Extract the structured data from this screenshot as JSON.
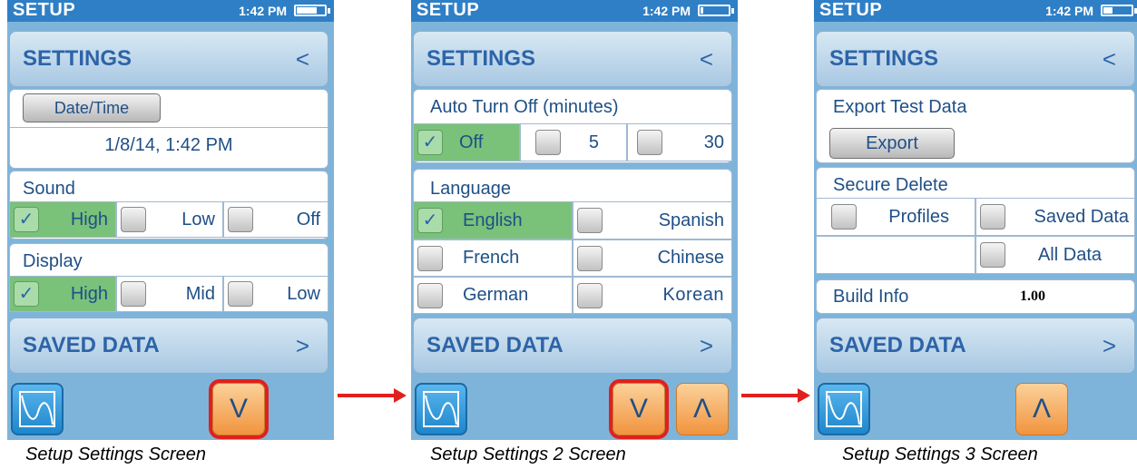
{
  "status": {
    "title": "SETUP",
    "time": "1:42 PM"
  },
  "nav": {
    "settings": "SETTINGS",
    "back_arrow": "<",
    "saved_data": "SAVED DATA",
    "forward_arrow": ">"
  },
  "screen1": {
    "date_time_button": "Date/Time",
    "date_time_value": "1/8/14, 1:42 PM",
    "sound": {
      "label": "Sound",
      "options": [
        "High",
        "Low",
        "Off"
      ],
      "selected": "High"
    },
    "display": {
      "label": "Display",
      "options": [
        "High",
        "Mid",
        "Low"
      ],
      "selected": "High"
    },
    "caption": "Setup Settings Screen",
    "battery_level": 0.65
  },
  "screen2": {
    "auto_turn_off": {
      "label": "Auto Turn Off (minutes)",
      "options": [
        "Off",
        "5",
        "30"
      ],
      "selected": "Off"
    },
    "language": {
      "label": "Language",
      "options": [
        "English",
        "Spanish",
        "French",
        "Chinese",
        "German",
        "Korean"
      ],
      "selected": "English"
    },
    "caption": "Setup Settings 2 Screen",
    "battery_level": 0.05
  },
  "screen3": {
    "export_test_data": {
      "label": "Export Test Data",
      "button": "Export"
    },
    "secure_delete": {
      "label": "Secure Delete",
      "options": [
        "Profiles",
        "Saved Data",
        "All Data"
      ]
    },
    "build_info": {
      "label": "Build Info",
      "value": "1.00"
    },
    "caption": "Setup Settings 3 Screen",
    "battery_level": 0.3
  },
  "buttons": {
    "down_symbol": "V",
    "up_symbol": "Λ"
  },
  "icons": {
    "check": "✓",
    "graph": "graph-icon",
    "red_arrow": "right-arrow-icon"
  },
  "colors": {
    "status_bar": "#2f7fc6",
    "screen_bg": "#7fb4da",
    "selected_green": "#7ac17a",
    "highlight_red": "#e0201e",
    "orange_button": "#f1943e",
    "label_blue": "#1f4f86"
  }
}
